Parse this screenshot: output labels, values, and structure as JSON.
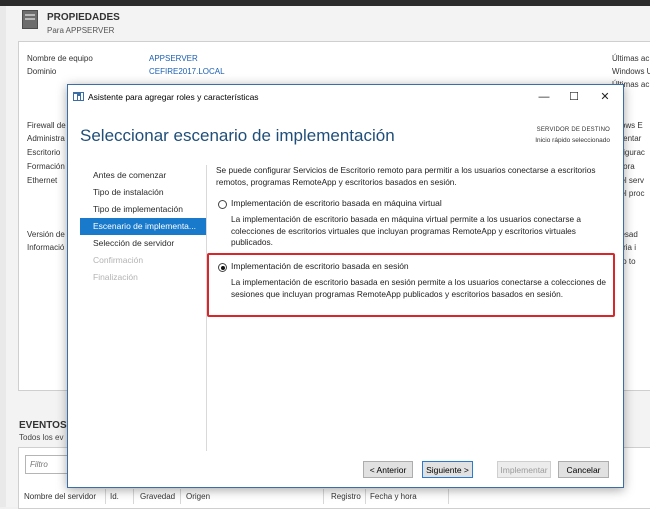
{
  "background": {
    "properties_title": "PROPIEDADES",
    "properties_subtitle": "Para APPSERVER",
    "fields": [
      {
        "label": "Nombre de equipo",
        "value": "APPSERVER"
      },
      {
        "label": "Dominio",
        "value": "CEFIRE2017.LOCAL"
      }
    ],
    "left_labels": [
      "Firewall de",
      "Administra",
      "Escritorio",
      "Formación",
      "Ethernet",
      "Versión de",
      "Informació"
    ],
    "right_labels": [
      "Últimas ac",
      "Windows U",
      "Últimas ac",
      "ndows E",
      "omentar",
      "onfigurac",
      "n hora",
      "l del serv",
      "l del proc",
      "ocesad",
      "moria i",
      "acio to"
    ],
    "events_title": "EVENTOS",
    "events_subtitle": "Todos los ev",
    "filter_placeholder": "Filtro",
    "event_columns": [
      "Nombre del servidor",
      "Id.",
      "Gravedad",
      "Origen",
      "Registro",
      "Fecha y hora"
    ]
  },
  "dialog": {
    "title": "Asistente para agregar roles y características",
    "heading": "Seleccionar escenario de implementación",
    "destination_label": "SERVIDOR DE DESTINO",
    "destination_value": "Inicio rápido seleccionado",
    "nav": [
      {
        "label": "Antes de comenzar",
        "state": "normal"
      },
      {
        "label": "Tipo de instalación",
        "state": "normal"
      },
      {
        "label": "Tipo de implementación",
        "state": "normal"
      },
      {
        "label": "Escenario de implementa...",
        "state": "active"
      },
      {
        "label": "Selección de servidor",
        "state": "normal"
      },
      {
        "label": "Confirmación",
        "state": "disabled"
      },
      {
        "label": "Finalización",
        "state": "disabled"
      }
    ],
    "intro": "Se puede configurar Servicios de Escritorio remoto para permitir a los usuarios conectarse a escritorios remotos, programas RemoteApp y escritorios basados en sesión.",
    "options": [
      {
        "label": "Implementación de escritorio basada en máquina virtual",
        "description": "La implementación de escritorio basada en máquina virtual permite a los usuarios conectarse a colecciones de escritorios virtuales que incluyan programas RemoteApp y escritorios virtuales publicados.",
        "selected": false
      },
      {
        "label": "Implementación de escritorio basada en sesión",
        "description": "La implementación de escritorio basada en sesión permite a los usuarios conectarse a colecciones de sesiones que incluyan programas RemoteApp publicados y escritorios basados en sesión.",
        "selected": true
      }
    ],
    "buttons": {
      "back": "< Anterior",
      "next": "Siguiente >",
      "install": "Implementar",
      "cancel": "Cancelar"
    },
    "highlight_color": "#d9262b",
    "accent_color": "#1979ca"
  }
}
